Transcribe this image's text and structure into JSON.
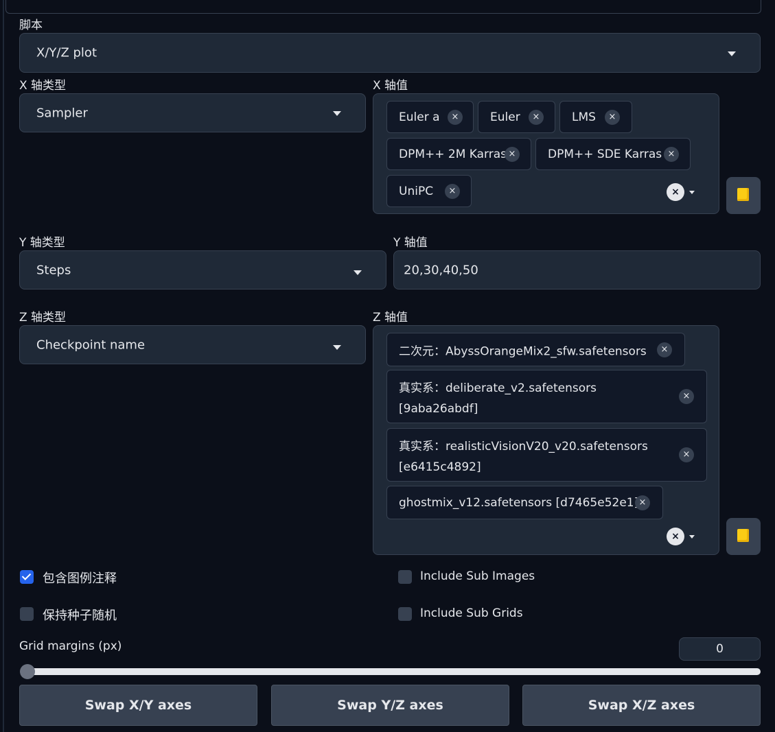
{
  "script": {
    "label": "脚本",
    "selected": "X/Y/Z plot"
  },
  "x_axis": {
    "type_label": "X 轴类型",
    "type_value": "Sampler",
    "values_label": "X 轴值",
    "tokens": [
      "Euler a",
      "Euler",
      "LMS",
      "DPM++ 2M Karras",
      "DPM++ SDE Karras",
      "UniPC"
    ]
  },
  "y_axis": {
    "type_label": "Y 轴类型",
    "type_value": "Steps",
    "values_label": "Y 轴值",
    "values_text": "20,30,40,50"
  },
  "z_axis": {
    "type_label": "Z 轴类型",
    "type_value": "Checkpoint name",
    "values_label": "Z 轴值",
    "tokens": [
      {
        "line1": "二次元：AbyssOrangeMix2_sfw.safetensors",
        "line2": ""
      },
      {
        "line1": "真实系：deliberate_v2.safetensors",
        "line2": "[9aba26abdf]"
      },
      {
        "line1": "真实系：realisticVisionV20_v20.safetensors",
        "line2": "[e6415c4892]"
      },
      {
        "line1": "ghostmix_v12.safetensors [d7465e52e1]",
        "line2": ""
      }
    ]
  },
  "options": {
    "include_legend": {
      "label": "包含图例注释",
      "checked": true
    },
    "keep_seed_random": {
      "label": "保持种子随机",
      "checked": false
    },
    "include_sub_images": {
      "label": "Include Sub Images",
      "checked": false
    },
    "include_sub_grids": {
      "label": "Include Sub Grids",
      "checked": false
    }
  },
  "grid_margins": {
    "label": "Grid margins (px)",
    "value": "0",
    "slider_fraction": 0
  },
  "buttons": {
    "swap_xy": "Swap X/Y axes",
    "swap_yz": "Swap Y/Z axes",
    "swap_xz": "Swap X/Z axes"
  },
  "icons": {
    "remove_token": "×",
    "clear_all": "×"
  },
  "colors": {
    "background": "#0b0f19",
    "panel": "#1f2937",
    "accent": "#2563eb",
    "folder": "#facc15"
  }
}
